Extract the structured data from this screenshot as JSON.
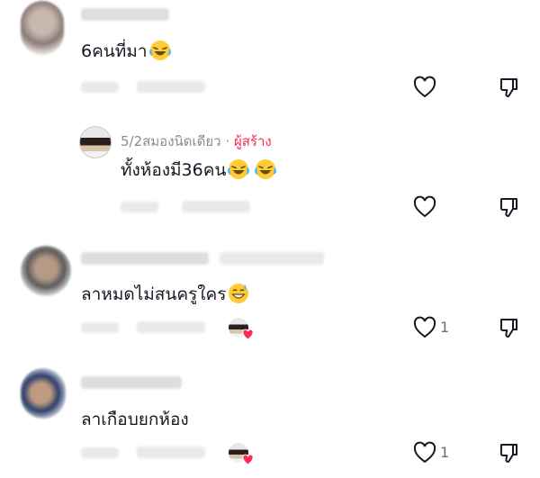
{
  "comments": [
    {
      "text": "6คนที่มา",
      "emoji": "face-with-tears-of-joy",
      "likes": ""
    },
    {
      "author": "5/2สมองนิดเดียว",
      "separator": "·",
      "creator_tag": "ผู้สร้าง",
      "text": "ทั้งห้องมี36คน",
      "emoji": "face-with-tears-of-joy",
      "likes": ""
    },
    {
      "text": "ลาหมดไม่สนครูใคร",
      "emoji": "grinning-face-with-sweat",
      "likes": "1"
    },
    {
      "text": "ลาเกือบยกห้อง",
      "likes": "1"
    }
  ],
  "colors": {
    "heart": "#fe2c55",
    "creator": "#fe2c55",
    "meta": "#8a8b91"
  }
}
